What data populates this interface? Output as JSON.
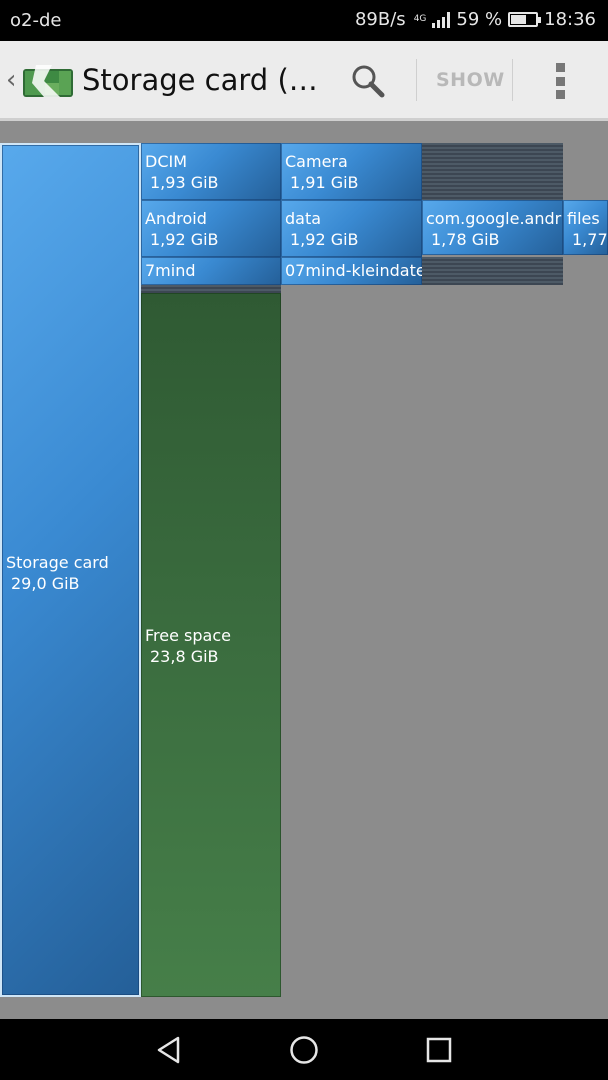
{
  "status_bar": {
    "carrier": "o2-de",
    "net_speed": "89B/s",
    "network_type": "4G",
    "battery": "59 %",
    "battery_level": 0.59,
    "time": "18:36"
  },
  "action_bar": {
    "back_icon": "chevron-left-icon",
    "app_icon": "disk-usage-app-icon",
    "title": "Storage card (…",
    "search_icon": "magnifier-icon",
    "show_label": "SHOW",
    "overflow_icon": "vertical-dots-icon"
  },
  "colors": {
    "folder_tile": "#3a8ad2",
    "free_space_tile": "#3b6d3f",
    "background": "#8c8c8c",
    "action_bar": "#ececec"
  },
  "treemap": {
    "root": {
      "name": "Storage card",
      "size": "29,0 GiB"
    },
    "free_space": {
      "name": "Free space",
      "size": "23,8 GiB"
    },
    "level1": [
      {
        "name": "DCIM",
        "size": "1,93 GiB"
      },
      {
        "name": "Android",
        "size": "1,92 GiB"
      },
      {
        "name": "7mind",
        "size": ""
      }
    ],
    "level2": [
      {
        "name": "Camera",
        "size": "1,91 GiB"
      },
      {
        "name": "data",
        "size": "1,92 GiB"
      },
      {
        "name": "07mind-kleindate",
        "size": ""
      }
    ],
    "level3": [
      {
        "name": "com.google.andr",
        "size": "1,78 GiB"
      }
    ],
    "level4": [
      {
        "name": "files",
        "size": "1,77"
      }
    ]
  },
  "nav_bar": {
    "back_icon": "triangle-back-icon",
    "home_icon": "circle-home-icon",
    "recents_icon": "square-recents-icon"
  }
}
